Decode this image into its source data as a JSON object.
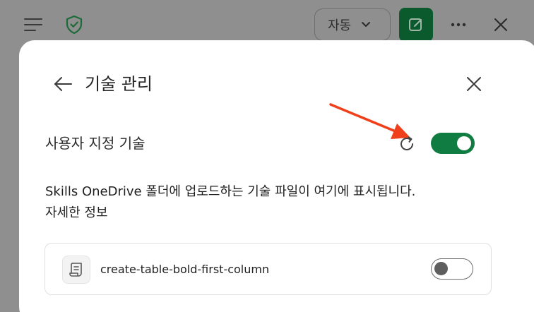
{
  "toolbar": {
    "mode_label": "자동",
    "icons": {
      "menu": "hamburger-menu-icon",
      "shield": "shield-check-icon",
      "new_chat": "edit-note-icon",
      "more": "more-icon",
      "close": "close-icon"
    },
    "shield_color": "#1e6b3a",
    "accent_dark": "#0b5a2e"
  },
  "panel": {
    "title": "기술 관리",
    "back_icon": "arrow-left-icon",
    "close_icon": "close-icon",
    "section": {
      "label": "사용자 지정 기술",
      "refresh_icon": "refresh-icon",
      "enabled": true,
      "toggle_color": "#107c41"
    },
    "description": "Skills OneDrive 폴더에 업로드하는 기술 파일이 여기에 표시됩니다.",
    "learn_more": "자세한 정보",
    "skills": [
      {
        "name": "create-table-bold-first-column",
        "icon": "script-icon",
        "enabled": false
      }
    ],
    "annotation_arrow_color": "#f0401b"
  }
}
